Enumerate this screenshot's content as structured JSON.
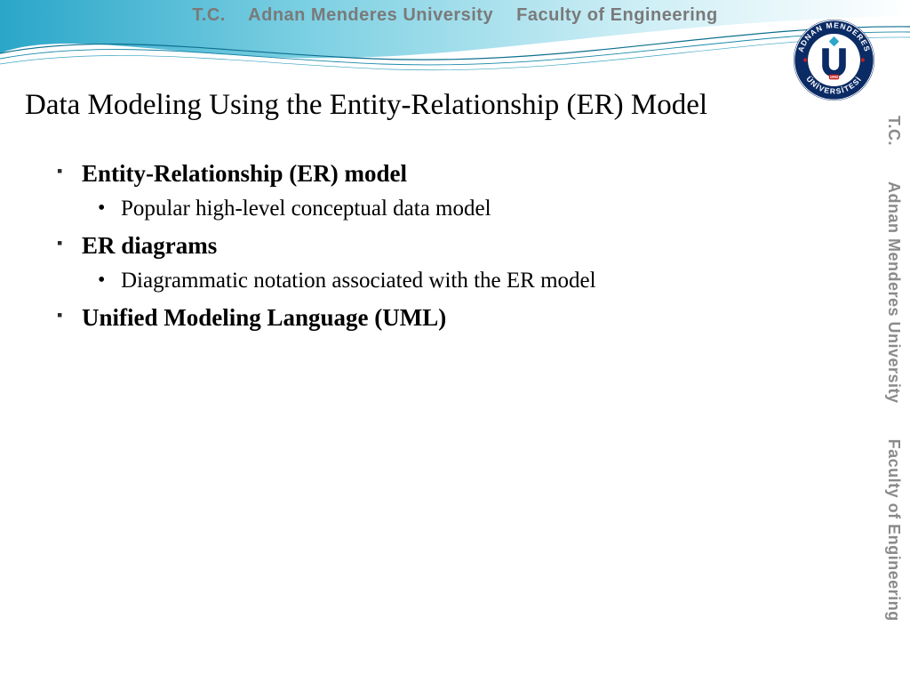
{
  "header": {
    "tc": "T.C.",
    "university": "Adnan Menderes University",
    "faculty": "Faculty of Engineering"
  },
  "seal": {
    "outer_top": "ADNAN MENDERES",
    "outer_bottom": "ÜNİVERSİTESİ",
    "year": "1992",
    "letter": "U"
  },
  "slide": {
    "title": "Data Modeling Using the Entity-Relationship (ER) Model",
    "bullets": [
      {
        "text": "Entity-Relationship (ER) model",
        "sub": [
          "Popular high-level conceptual data model"
        ]
      },
      {
        "text": "ER diagrams",
        "sub": [
          "Diagrammatic notation associated with the ER model"
        ]
      },
      {
        "text": "Unified Modeling Language (UML)",
        "sub": []
      }
    ]
  },
  "colors": {
    "wave_light": "#bfe9f2",
    "wave_dark": "#2aa6c9",
    "seal_ring": "#0b2b65",
    "seal_red": "#c22020"
  }
}
